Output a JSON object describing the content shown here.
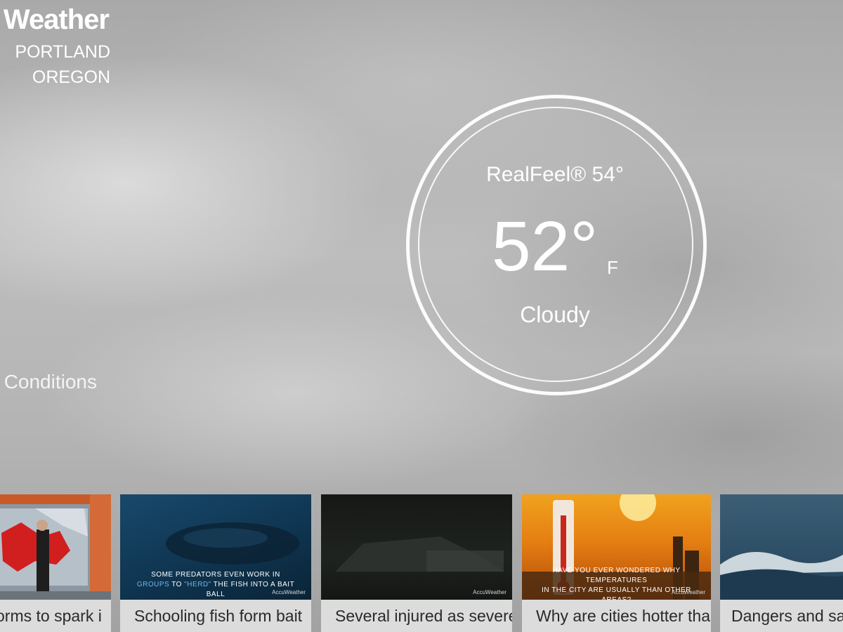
{
  "header": {
    "brand": "Weather",
    "city": "PORTLAND",
    "state": "OREGON"
  },
  "current": {
    "realfeel": "RealFeel® 54°",
    "temperature": "52°",
    "unit": "F",
    "condition": "Cloudy"
  },
  "section": {
    "conditions_label": "Conditions"
  },
  "videos": [
    {
      "title": "orms to spark i"
    },
    {
      "title": "Schooling fish form bait",
      "caption_pre": "SOME PREDATORS EVEN WORK IN ",
      "caption_hl1": "GROUPS",
      "caption_mid": " TO ",
      "caption_hl2": "\"HERD\"",
      "caption_post": " THE FISH INTO A BAIT BALL",
      "watermark": "AccuWeather"
    },
    {
      "title": "Several injured as severe",
      "watermark": "AccuWeather"
    },
    {
      "title": "Why are cities hotter than",
      "caption_line1": "HAVE YOU EVER WONDERED WHY TEMPERATURES",
      "caption_line2": "IN THE CITY ARE USUALLY        THAN OTHER AREAS?",
      "watermark": "AccuWeather"
    },
    {
      "title": "Dangers and safe"
    }
  ],
  "colors": {
    "caption_highlight": "#6fb7e6",
    "card_title_bg": "#dcdcdc"
  }
}
